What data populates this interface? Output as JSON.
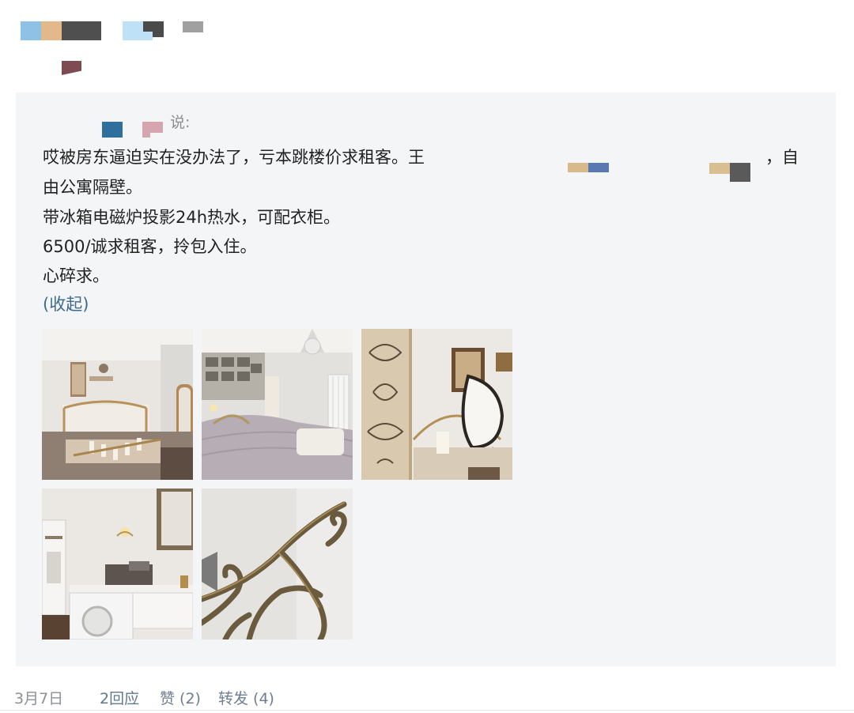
{
  "quote": {
    "said_label": "说:",
    "lines": [
      "哎被房东逼迫实在没办法了，亏本跳楼价求租客。王",
      "由公寓隔壁。",
      "带冰箱电磁炉投影24h热水，可配衣柜。",
      "6500/诚求租客，拎包入住。",
      "心碎求。"
    ],
    "line1_tail": "，自",
    "collapse": "(收起)"
  },
  "photos": [
    {
      "subject": "bedroom-brass-bed"
    },
    {
      "subject": "bedroom-projector"
    },
    {
      "subject": "mirror-and-wallpaper"
    },
    {
      "subject": "kitchen-washer"
    },
    {
      "subject": "iron-headboard-detail"
    }
  ],
  "footer": {
    "date": "3月7日",
    "replies": "2回应",
    "like": "赞 (2)",
    "share": "转发 (4)"
  },
  "colors": {
    "quote_bg": "#f4f5f7",
    "link": "#3d6c8c",
    "meta": "#8d9095"
  }
}
